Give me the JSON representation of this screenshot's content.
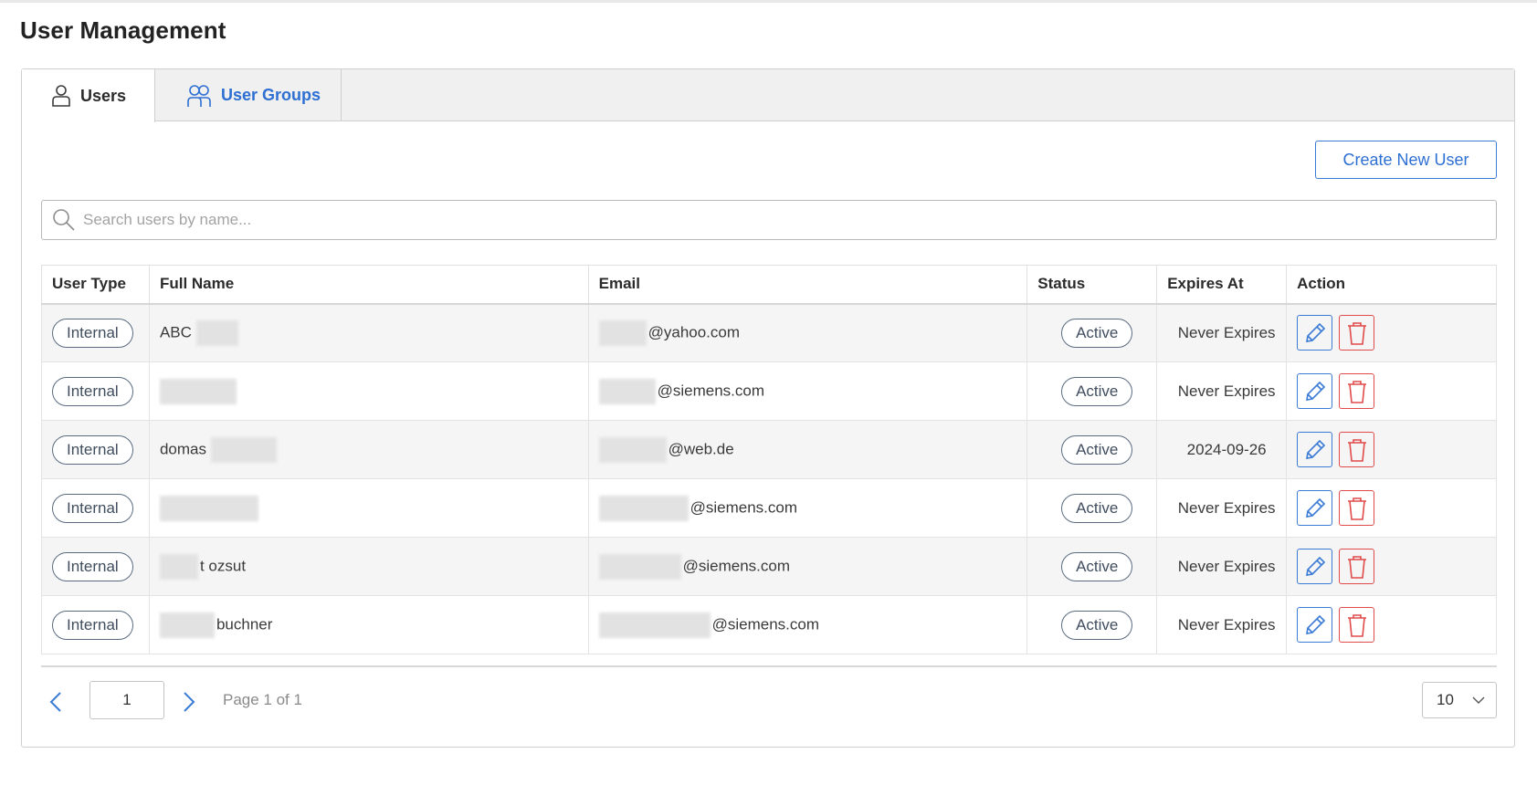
{
  "page": {
    "title": "User Management"
  },
  "tabs": [
    {
      "label": "Users",
      "icon": "user-icon",
      "active": true
    },
    {
      "label": "User Groups",
      "icon": "users-group-icon",
      "active": false
    }
  ],
  "toolbar": {
    "create_label": "Create New User"
  },
  "search": {
    "placeholder": "Search users by name...",
    "value": ""
  },
  "table": {
    "columns": [
      "User Type",
      "Full Name",
      "Email",
      "Status",
      "Expires At",
      "Action"
    ],
    "rows": [
      {
        "type": "Internal",
        "name": "ABC",
        "email": "@yahoo.com",
        "status": "Active",
        "expires": "Never Expires"
      },
      {
        "type": "Internal",
        "name": "",
        "email": "@siemens.com",
        "status": "Active",
        "expires": "Never Expires"
      },
      {
        "type": "Internal",
        "name": "domas",
        "email": "@web.de",
        "status": "Active",
        "expires": "2024-09-26"
      },
      {
        "type": "Internal",
        "name": "",
        "email": "@siemens.com",
        "status": "Active",
        "expires": "Never Expires"
      },
      {
        "type": "Internal",
        "name": "t ozsut",
        "email": "@siemens.com",
        "status": "Active",
        "expires": "Never Expires"
      },
      {
        "type": "Internal",
        "name": "buchner",
        "email": "@siemens.com",
        "status": "Active",
        "expires": "Never Expires"
      }
    ]
  },
  "pagination": {
    "current_page": "1",
    "info": "Page 1 of 1",
    "page_size": "10"
  },
  "colors": {
    "accent": "#2d6fd2",
    "danger": "#e14a4a",
    "pill_border": "#5a6b80"
  }
}
